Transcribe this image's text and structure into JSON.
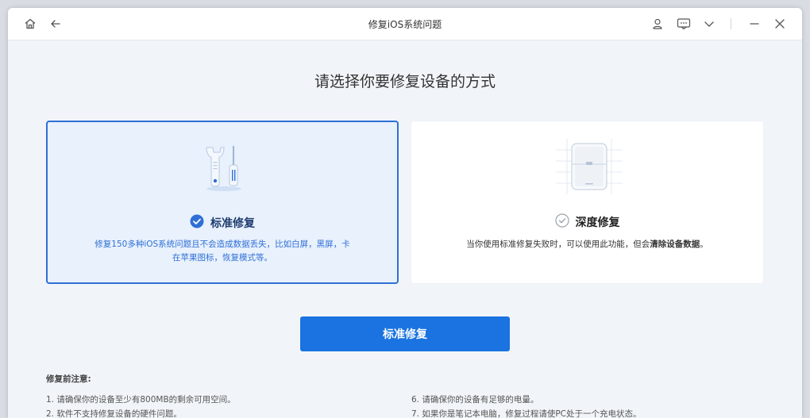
{
  "window": {
    "title": "修复iOS系统问题"
  },
  "heading": "请选择你要修复设备的方式",
  "cards": {
    "standard": {
      "title": "标准修复",
      "desc_line1": "修复150多种iOS系统问题且不会造成数据丢失，比如白屏，黑屏，卡",
      "desc_line2": "在苹果图标，恢复模式等。",
      "selected": true
    },
    "deep": {
      "title": "深度修复",
      "desc_prefix": "当你使用标准修复失败时，可以使用此功能，但会",
      "desc_bold": "清除设备数据",
      "desc_suffix": "。",
      "selected": false
    }
  },
  "primary_button": "标准修复",
  "notes": {
    "title": "修复前注意:",
    "items": [
      "1.  请确保你的设备至少有800MB的剩余可用空间。",
      "2.  软件不支持修复设备的硬件问题。",
      "6.  请确保你的设备有足够的电量。",
      "7.  如果你是笔记本电脑，修复过程请使PC处于一个充电状态。"
    ]
  },
  "colors": {
    "accent": "#1a73e0",
    "selected_border": "#2f6fd6",
    "selected_bg": "#e8f1fc"
  },
  "icons": [
    "home-icon",
    "back-arrow-icon",
    "user-icon",
    "feedback-icon",
    "chevron-down-icon",
    "minimize-icon",
    "close-icon",
    "tools-icon",
    "check-circle-icon",
    "device-icon"
  ]
}
